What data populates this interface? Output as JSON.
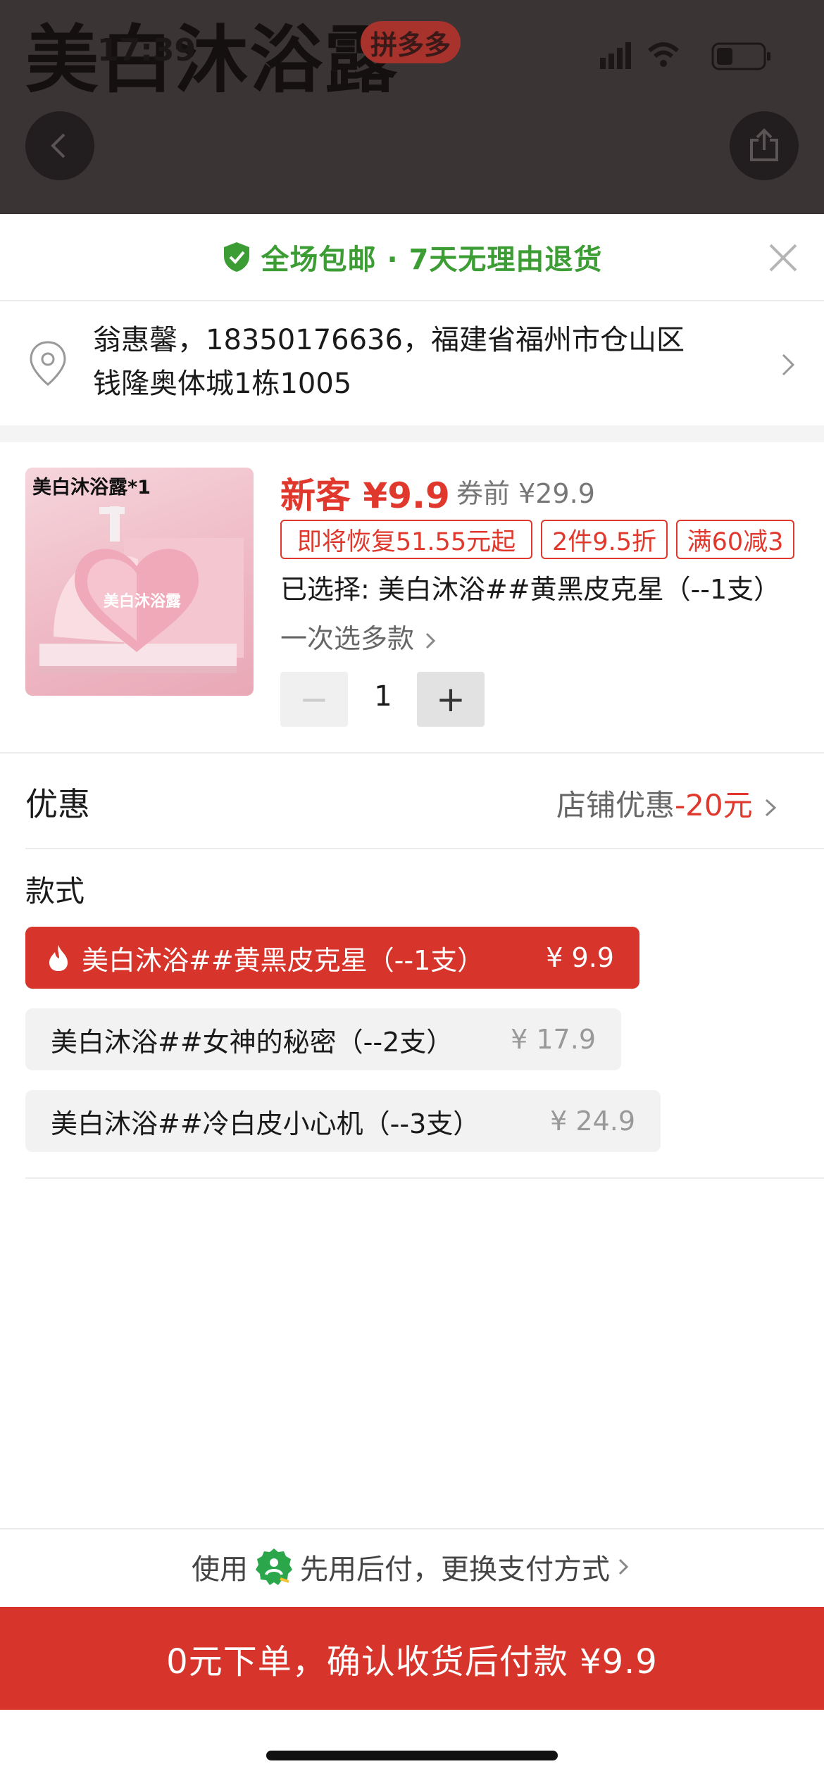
{
  "background": {
    "title": "美白沐浴露",
    "badge": "拼多多",
    "status_time": "17:39"
  },
  "banner": {
    "text": "全场包邮 · 7天无理由退货"
  },
  "address": {
    "line1": "翁惠馨，18350176636，福建省福州市仓山区",
    "line2": "钱隆奥体城1栋1005"
  },
  "product": {
    "image_label": "美白沐浴露*1",
    "bottle_text": "美白沐浴露",
    "new_price": "新客 ¥9.9",
    "old_price": "券前 ¥29.9",
    "tags": [
      "即将恢复51.55元起",
      "2件9.5折",
      "满60减3"
    ],
    "selected": "已选择: 美白沐浴##黄黑皮克星（--1支）",
    "multi_select": "一次选多款",
    "quantity": "1",
    "minus": "−",
    "plus": "+"
  },
  "promo": {
    "label": "优惠",
    "value_prefix": "店铺优惠",
    "value_amount": "-20元"
  },
  "styles": {
    "label": "款式",
    "options": [
      {
        "name": "美白沐浴##黄黑皮克星（--1支）",
        "price": "¥ 9.9",
        "selected": true
      },
      {
        "name": "美白沐浴##女神的秘密（--2支）",
        "price": "¥ 17.9",
        "selected": false
      },
      {
        "name": "美白沐浴##冷白皮小心机（--3支）",
        "price": "¥ 24.9",
        "selected": false
      }
    ]
  },
  "payment": {
    "prefix": "使用",
    "text": "先用后付，更换支付方式"
  },
  "cta": {
    "label": "0元下单，确认收货后付款 ¥9.9"
  },
  "colors": {
    "accent": "#d7352b",
    "green": "#3c9d34",
    "dim": "#3a3435"
  },
  "icons": [
    "back-icon",
    "share-icon",
    "shield-check-icon",
    "close-icon",
    "location-pin-icon",
    "chevron-right-icon",
    "fire-icon",
    "pay-later-icon"
  ]
}
